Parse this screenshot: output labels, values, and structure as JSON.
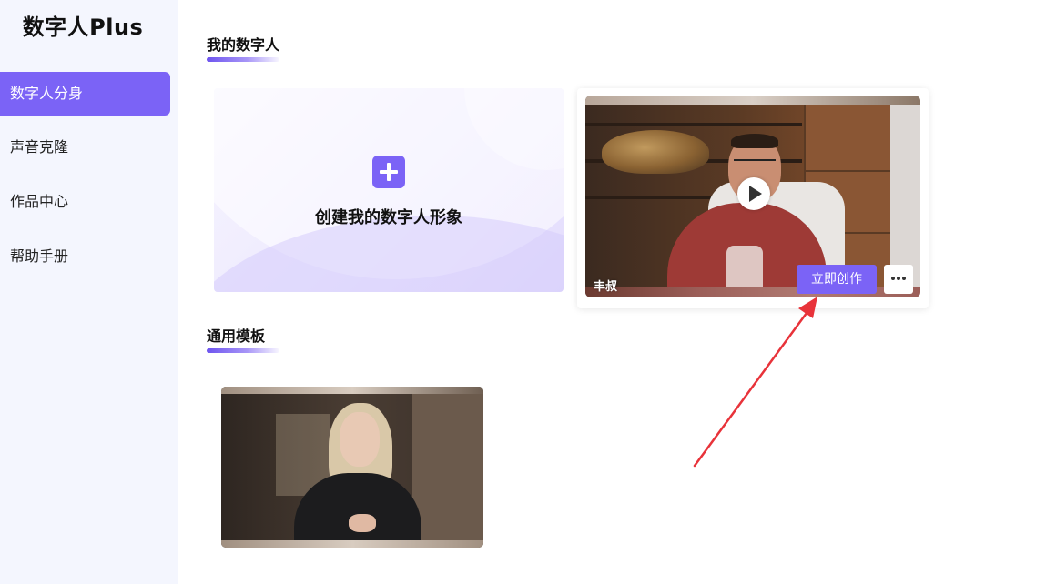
{
  "brand": {
    "title": "数字人Plus"
  },
  "sidebar": {
    "items": [
      {
        "label": "数字人分身",
        "active": true
      },
      {
        "label": "声音克隆",
        "active": false
      },
      {
        "label": "作品中心",
        "active": false
      },
      {
        "label": "帮助手册",
        "active": false
      }
    ]
  },
  "sections": {
    "my_avatars": {
      "title": "我的数字人",
      "create_card": {
        "label": "创建我的数字人形象",
        "icon": "plus-icon"
      },
      "avatar_card": {
        "name": "丰叔",
        "create_button": "立即创作",
        "more_icon": "more-icon",
        "play_icon": "play-icon"
      }
    },
    "templates": {
      "title": "通用模板"
    }
  },
  "annotation": {
    "type": "red-arrow",
    "color": "#e8333a"
  },
  "colors": {
    "accent": "#7b63f6",
    "sidebar_bg": "#f4f6fe"
  }
}
